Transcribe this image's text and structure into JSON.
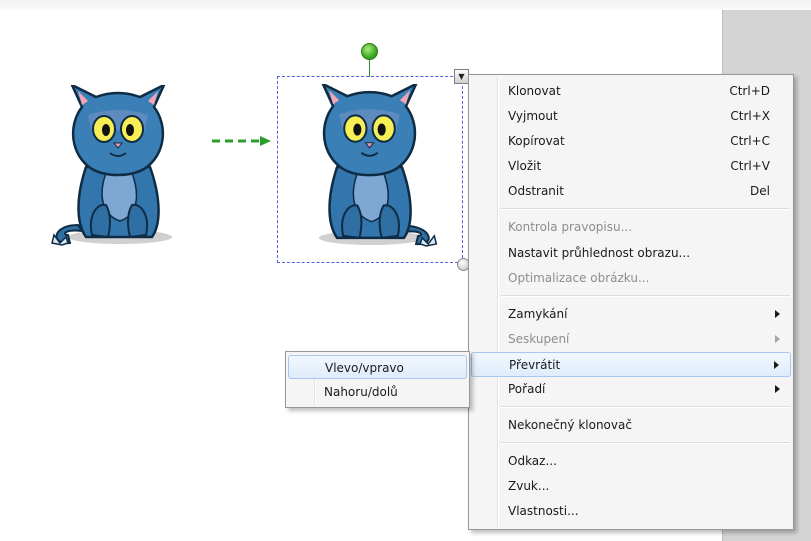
{
  "canvas": {
    "background": "#ffffff",
    "side_panel_color": "#d4d4d4",
    "objects": [
      {
        "name": "cat-image",
        "icon": "blue-cat-cartoon"
      },
      {
        "name": "cat-image",
        "icon": "blue-cat-cartoon",
        "selected": true
      }
    ],
    "arrow_color": "#2a9d2a"
  },
  "context_menu": {
    "groups": [
      [
        {
          "label": "Klonovat",
          "shortcut": "Ctrl+D"
        },
        {
          "label": "Vyjmout",
          "shortcut": "Ctrl+X"
        },
        {
          "label": "Kopírovat",
          "shortcut": "Ctrl+C"
        },
        {
          "label": "Vložit",
          "shortcut": "Ctrl+V"
        },
        {
          "label": "Odstranit",
          "shortcut": "Del"
        }
      ],
      [
        {
          "label": "Kontrola pravopisu...",
          "disabled": true
        },
        {
          "label": "Nastavit průhlednost obrazu..."
        },
        {
          "label": "Optimalizace obrázku...",
          "disabled": true
        }
      ],
      [
        {
          "label": "Zamykání",
          "submenu": true
        },
        {
          "label": "Seskupení",
          "submenu": true,
          "disabled": true
        },
        {
          "label": "Převrátit",
          "submenu": true,
          "highlighted": true
        },
        {
          "label": "Pořadí",
          "submenu": true
        }
      ],
      [
        {
          "label": "Nekonečný klonovač"
        }
      ],
      [
        {
          "label": "Odkaz..."
        },
        {
          "label": "Zvuk..."
        },
        {
          "label": "Vlastnosti..."
        }
      ]
    ]
  },
  "flip_submenu": {
    "items": [
      {
        "label": "Vlevo/vpravo",
        "highlighted": true
      },
      {
        "label": "Nahoru/dolů"
      }
    ]
  }
}
